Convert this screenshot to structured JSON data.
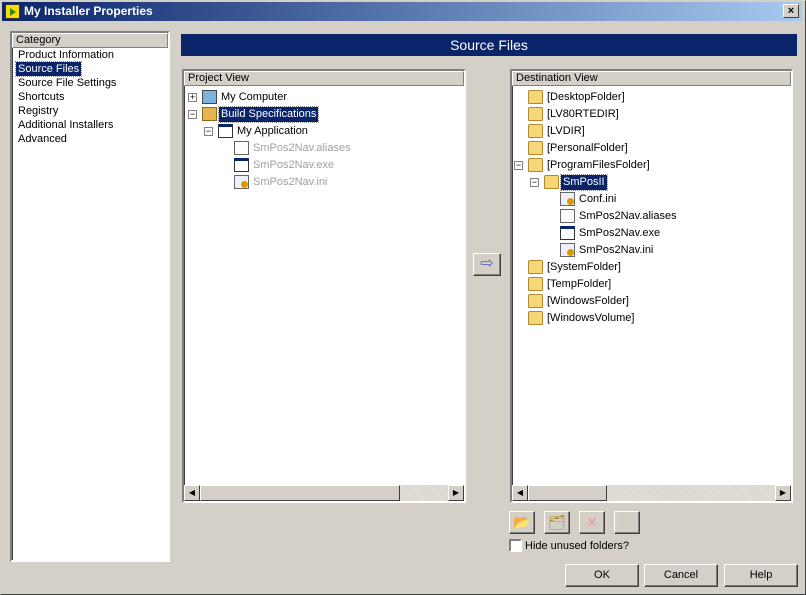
{
  "window": {
    "title": "My Installer Properties",
    "close": "×"
  },
  "category": {
    "header": "Category",
    "items": [
      "Product Information",
      "Source Files",
      "Source File Settings",
      "Shortcuts",
      "Registry",
      "Additional Installers",
      "Advanced"
    ],
    "selected": 1
  },
  "page_title": "Source Files",
  "project_view": {
    "header": "Project View",
    "items": [
      {
        "label": "My Computer",
        "icon": "comp",
        "depth": 0,
        "exp": "+"
      },
      {
        "label": "Build Specifications",
        "icon": "build",
        "depth": 0,
        "exp": "−",
        "selected": true
      },
      {
        "label": "My Application",
        "icon": "exe",
        "depth": 1,
        "exp": "−"
      },
      {
        "label": "SmPos2Nav.aliases",
        "icon": "file",
        "depth": 2,
        "dim": true
      },
      {
        "label": "SmPos2Nav.exe",
        "icon": "exe",
        "depth": 2,
        "dim": true
      },
      {
        "label": "SmPos2Nav.ini",
        "icon": "ini",
        "depth": 2,
        "dim": true
      }
    ]
  },
  "add_arrow": "⇨",
  "destination_view": {
    "header": "Destination View",
    "items": [
      {
        "label": "[DesktopFolder]",
        "icon": "folder",
        "depth": 0
      },
      {
        "label": "[LV80RTEDIR]",
        "icon": "folder",
        "depth": 0
      },
      {
        "label": "[LVDIR]",
        "icon": "folder",
        "depth": 0
      },
      {
        "label": "[PersonalFolder]",
        "icon": "folder",
        "depth": 0
      },
      {
        "label": "[ProgramFilesFolder]",
        "icon": "folder",
        "depth": 0,
        "exp": "−"
      },
      {
        "label": "SmPosII",
        "icon": "folder",
        "depth": 1,
        "exp": "−",
        "selected": true
      },
      {
        "label": "Conf.ini",
        "icon": "ini",
        "depth": 2
      },
      {
        "label": "SmPos2Nav.aliases",
        "icon": "file",
        "depth": 2
      },
      {
        "label": "SmPos2Nav.exe",
        "icon": "exe",
        "depth": 2
      },
      {
        "label": "SmPos2Nav.ini",
        "icon": "ini",
        "depth": 2
      },
      {
        "label": "[SystemFolder]",
        "icon": "folder",
        "depth": 0
      },
      {
        "label": "[TempFolder]",
        "icon": "folder",
        "depth": 0
      },
      {
        "label": "[WindowsFolder]",
        "icon": "folder",
        "depth": 0
      },
      {
        "label": "[WindowsVolume]",
        "icon": "folder",
        "depth": 0
      }
    ]
  },
  "toolbar": {
    "new_folder": "📂",
    "rename": "🗂",
    "delete": "✕",
    "set_default": "🗀"
  },
  "hide_unused_label": "Hide unused folders?",
  "buttons": {
    "ok": "OK",
    "cancel": "Cancel",
    "help": "Help"
  },
  "scroll": {
    "left": "◀",
    "right": "▶"
  }
}
